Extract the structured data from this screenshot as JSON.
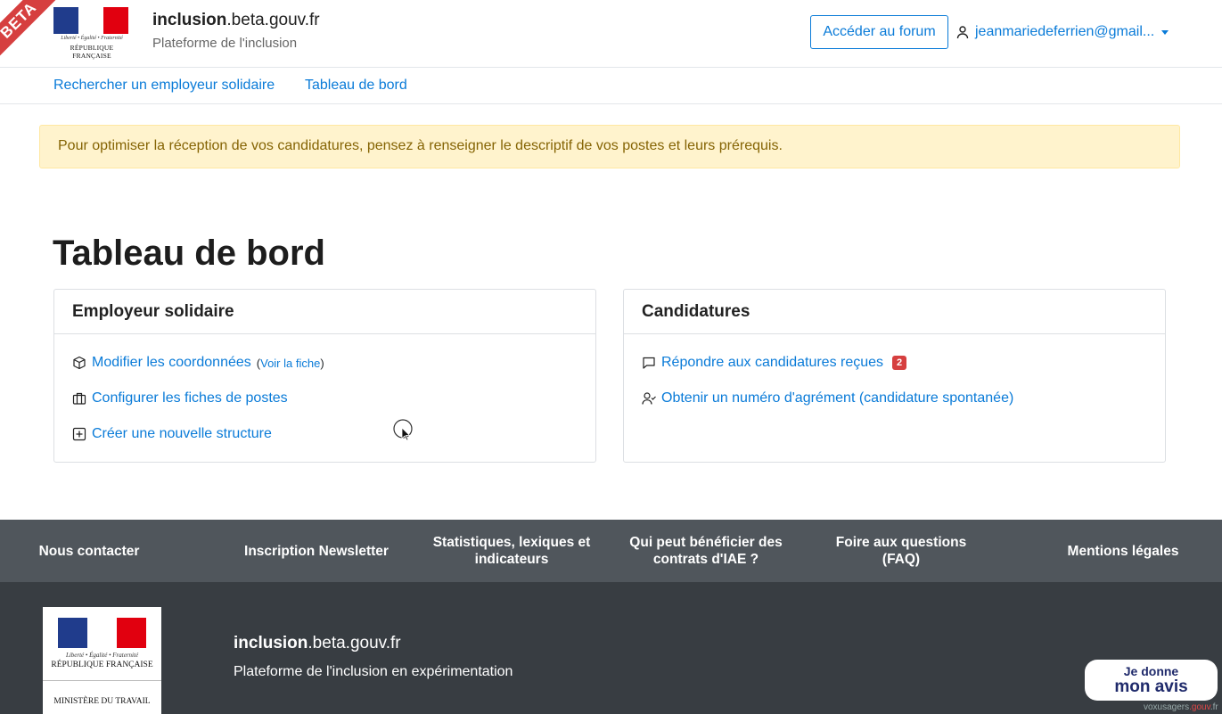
{
  "header": {
    "beta": "BETA",
    "logo_motto": "Liberté • Égalité • Fraternité",
    "logo_republique": "RÉPUBLIQUE FRANÇAISE",
    "site_name_bold": "inclusion",
    "site_name_rest": ".beta.gouv.fr",
    "subtitle": "Plateforme de l'inclusion",
    "forum_button": "Accéder au forum",
    "user_email": "jeanmariedeferrien@gmail..."
  },
  "nav": {
    "items": [
      "Rechercher un employeur solidaire",
      "Tableau de bord"
    ]
  },
  "alert": "Pour optimiser la réception de vos candidatures, pensez à renseigner le descriptif de vos postes et leurs prérequis.",
  "page_title": "Tableau de bord",
  "cards": {
    "employer": {
      "title": "Employeur solidaire",
      "modify": "Modifier les coordonnées",
      "view_open": "(",
      "view_link": "Voir la fiche",
      "view_close": ")",
      "configure": "Configurer les fiches de postes",
      "create": "Créer une nouvelle structure"
    },
    "candidatures": {
      "title": "Candidatures",
      "respond": "Répondre aux candidatures reçues",
      "badge": "2",
      "agrement": "Obtenir un numéro d'agrément (candidature spontanée)"
    }
  },
  "footer": {
    "links": [
      "Nous contacter",
      "Inscription Newsletter",
      "Statistiques, lexiques et indicateurs",
      "Qui peut bénéficier des contrats d'IAE ?",
      "Foire aux questions (FAQ)",
      "Mentions légales"
    ],
    "logo_motto": "Liberté • Égalité • Fraternité",
    "logo_republique": "RÉPUBLIQUE FRANÇAISE",
    "ministry": "MINISTÈRE DU TRAVAIL",
    "site_name_bold": "inclusion",
    "site_name_rest": ".beta.gouv.fr",
    "subtitle": "Plateforme de l'inclusion en expérimentation",
    "avis_line1": "Je donne",
    "avis_line2": "mon avis",
    "usagers_pre": "voxusagers",
    "usagers_red": ".gouv",
    "usagers_post": ".fr"
  },
  "colors": {
    "link": "#0a7bd8",
    "badge": "#d63f3f",
    "alert_bg": "#fff3cd",
    "footer_links_bg": "#50565c",
    "footer_bg": "#383d42"
  }
}
